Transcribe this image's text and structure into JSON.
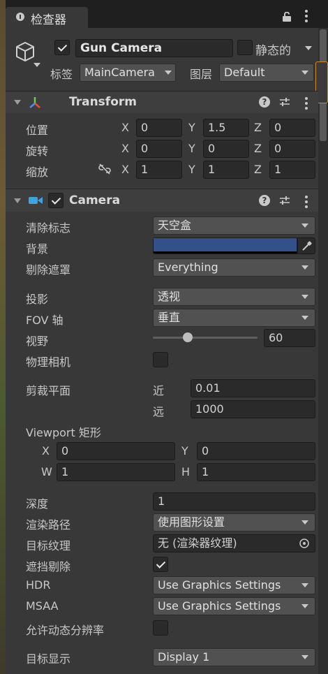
{
  "window": {
    "tab_label": "检查器"
  },
  "header": {
    "name": "Gun Camera",
    "static_label": "静态的",
    "tag_label": "标签",
    "tag_value": "MainCamera",
    "layer_label": "图层",
    "layer_value": "Default"
  },
  "transform": {
    "title": "Transform",
    "position": {
      "label": "位置",
      "x": "0",
      "y": "1.5",
      "z": "0"
    },
    "rotation": {
      "label": "旋转",
      "x": "0",
      "y": "0",
      "z": "0"
    },
    "scale": {
      "label": "缩放",
      "x": "1",
      "y": "1",
      "z": "1"
    },
    "axis": {
      "x": "X",
      "y": "Y",
      "z": "Z"
    }
  },
  "camera": {
    "title": "Camera",
    "clear_flags": {
      "label": "清除标志",
      "value": "天空盒"
    },
    "background": {
      "label": "背景",
      "color": "#34508a"
    },
    "culling_mask": {
      "label": "剔除遮罩",
      "value": "Everything"
    },
    "projection": {
      "label": "投影",
      "value": "透视"
    },
    "fov_axis": {
      "label": "FOV 轴",
      "value": "垂直"
    },
    "fov": {
      "label": "视野",
      "value": "60",
      "level": 0.33
    },
    "physical_camera": {
      "label": "物理相机"
    },
    "clipping": {
      "label": "剪裁平面",
      "near_label": "近",
      "near": "0.01",
      "far_label": "远",
      "far": "1000"
    },
    "viewport": {
      "label": "Viewport 矩形",
      "x_label": "X",
      "x": "0",
      "y_label": "Y",
      "y": "0",
      "w_label": "W",
      "w": "1",
      "h_label": "H",
      "h": "1"
    },
    "depth": {
      "label": "深度",
      "value": "1"
    },
    "rendering_path": {
      "label": "渲染路径",
      "value": "使用图形设置"
    },
    "target_texture": {
      "label": "目标纹理",
      "value": "无 (渲染器纹理)"
    },
    "occlusion_culling": {
      "label": "遮挡剔除"
    },
    "hdr": {
      "label": "HDR",
      "value": "Use Graphics Settings"
    },
    "msaa": {
      "label": "MSAA",
      "value": "Use Graphics Settings"
    },
    "dynamic_resolution": {
      "label": "允许动态分辨率"
    },
    "target_display": {
      "label": "目标显示",
      "value": "Display 1"
    }
  },
  "colors": {
    "panel": "#383838",
    "field": "#2a2a2a",
    "accent": "#d08a2a"
  },
  "icons": [
    "info-icon",
    "lock-icon",
    "cube-icon",
    "transform-axes-icon",
    "camera-icon",
    "help-icon",
    "preset-sliders-icon",
    "unlinked-icon",
    "eyedropper-icon",
    "object-picker-icon"
  ]
}
